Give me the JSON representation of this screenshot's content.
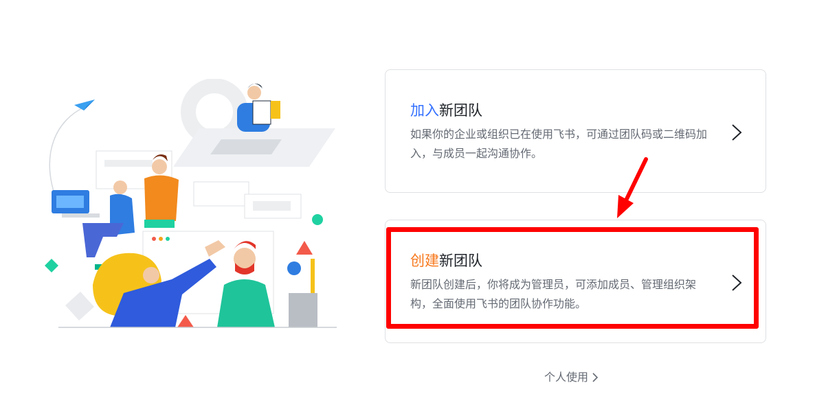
{
  "join_card": {
    "title_accent": "加入",
    "title_rest": "新团队",
    "description": "如果你的企业或组织已在使用飞书，可通过团队码或二维码加入，与成员一起沟通协作。"
  },
  "create_card": {
    "title_accent": "创建",
    "title_rest": "新团队",
    "description": "新团队创建后，你将成为管理员，可添加成员、管理组织架构，全面使用飞书的团队协作功能。"
  },
  "personal_link": {
    "label": "个人使用"
  },
  "colors": {
    "join_accent": "#3370ff",
    "create_accent": "#f77a1f",
    "highlight": "#ff0000"
  },
  "icons": [
    "chevron-right-icon",
    "paper-plane-icon",
    "team-illustration"
  ]
}
